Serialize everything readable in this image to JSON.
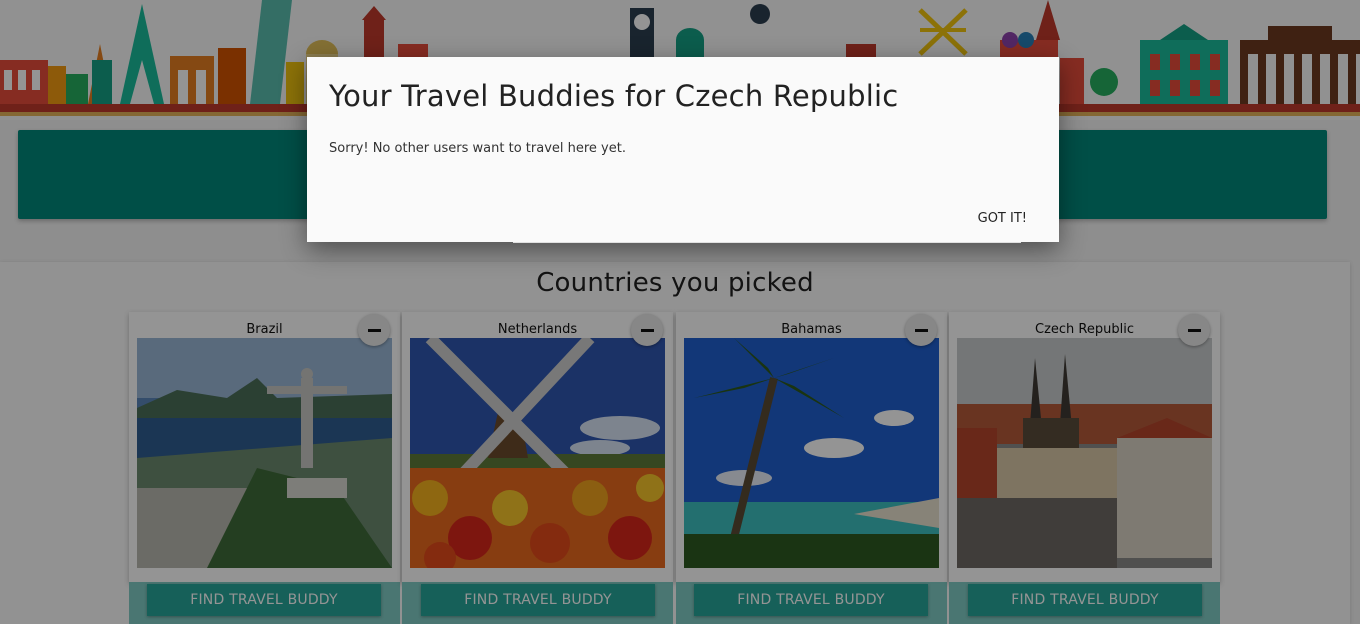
{
  "modal": {
    "title": "Your Travel Buddies for Czech Republic",
    "message": "Sorry! No other users want to travel here yet.",
    "action_label": "GOT IT!"
  },
  "section": {
    "title": "Countries you picked"
  },
  "cards": [
    {
      "name": "Brazil",
      "button_label": "FIND TRAVEL BUDDY",
      "image_icon": "rio-de-janeiro-photo"
    },
    {
      "name": "Netherlands",
      "button_label": "FIND TRAVEL BUDDY",
      "image_icon": "windmill-tulips-photo"
    },
    {
      "name": "Bahamas",
      "button_label": "FIND TRAVEL BUDDY",
      "image_icon": "palm-beach-photo"
    },
    {
      "name": "Czech Republic",
      "button_label": "FIND TRAVEL BUDDY",
      "image_icon": "prague-old-town-photo"
    }
  ],
  "colors": {
    "accent": "#00897b",
    "button": "#26a69a",
    "button_strip": "#80cbc4"
  }
}
